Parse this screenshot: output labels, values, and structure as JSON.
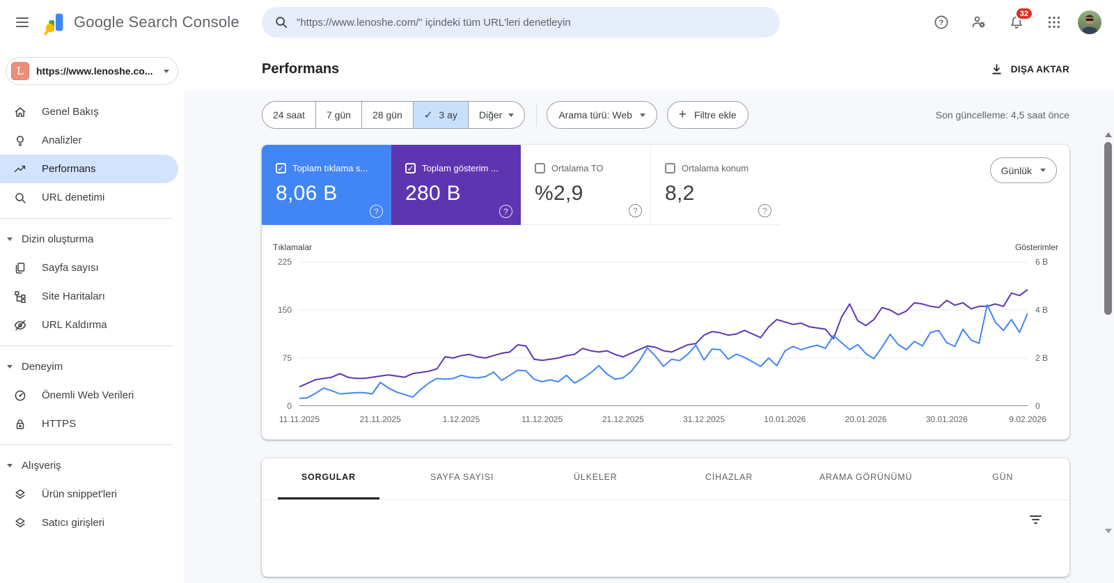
{
  "header": {
    "app_title": "Google Search Console",
    "search_placeholder": "\"https://www.lenoshe.com/\" içindeki tüm URL'leri denetleyin",
    "notification_count": "32"
  },
  "sidebar": {
    "property_badge": "L",
    "property_label": "https://www.lenoshe.co...",
    "nav": [
      {
        "type": "item",
        "icon": "home-icon",
        "label": "Genel Bakış"
      },
      {
        "type": "item",
        "icon": "lightbulb-icon",
        "label": "Analizler"
      },
      {
        "type": "item",
        "icon": "trending-up-icon",
        "label": "Performans",
        "selected": true
      },
      {
        "type": "item",
        "icon": "search-icon",
        "label": "URL denetimi"
      },
      {
        "type": "divider"
      },
      {
        "type": "section",
        "label": "Dizin oluşturma"
      },
      {
        "type": "item",
        "icon": "pages-icon",
        "label": "Sayfa sayısı"
      },
      {
        "type": "item",
        "icon": "sitemap-icon",
        "label": "Site Haritaları"
      },
      {
        "type": "item",
        "icon": "eye-off-icon",
        "label": "URL Kaldırma"
      },
      {
        "type": "divider"
      },
      {
        "type": "section",
        "label": "Deneyim"
      },
      {
        "type": "item",
        "icon": "speedometer-icon",
        "label": "Önemli Web Verileri"
      },
      {
        "type": "item",
        "icon": "lock-icon",
        "label": "HTTPS"
      },
      {
        "type": "divider"
      },
      {
        "type": "section",
        "label": "Alışveriş"
      },
      {
        "type": "item",
        "icon": "layers-icon",
        "label": "Ürün snippet'leri"
      },
      {
        "type": "item",
        "icon": "layers-icon",
        "label": "Satıcı girişleri"
      }
    ]
  },
  "page": {
    "title": "Performans",
    "export_label": "DIŞA AKTAR",
    "last_update": "Son güncelleme: 4,5 saat önce",
    "range_24h": "24 saat",
    "range_7d": "7 gün",
    "range_28d": "28 gün",
    "range_3m": "3 ay",
    "range_more": "Diğer",
    "search_type": "Arama türü: Web",
    "add_filter": "Filtre ekle",
    "granularity": "Günlük"
  },
  "metrics": [
    {
      "label": "Toplam tıklama s...",
      "value": "8,06 B",
      "checked": true,
      "color": "#4285f4"
    },
    {
      "label": "Toplam gösterim ...",
      "value": "280 B",
      "checked": true,
      "color": "#5e35b1"
    },
    {
      "label": "Ortalama TO",
      "value": "%2,9",
      "checked": false
    },
    {
      "label": "Ortalama konum",
      "value": "8,2",
      "checked": false
    }
  ],
  "tabs": [
    "SORGULAR",
    "SAYFA SAYISI",
    "ÜLKELER",
    "CİHAZLAR",
    "ARAMA GÖRÜNÜMÜ",
    "GÜN"
  ],
  "chart_data": {
    "type": "line",
    "title": "Performans: tıklamalar ve gösterimler (3 ay, günlük)",
    "legend_position": "none",
    "grid": true,
    "x_start": "11.11.2025",
    "x_end": "9.02.2026",
    "x_ticks": [
      "11.11.2025",
      "21.11.2025",
      "1.12.2025",
      "11.12.2025",
      "21.12.2025",
      "31.12.2025",
      "10.01.2026",
      "20.01.2026",
      "30.01.2026",
      "9.02.2026"
    ],
    "left_axis": {
      "label": "Tıklamalar",
      "ticks": [
        "225",
        "150",
        "75",
        "0"
      ],
      "min": 0,
      "max": 225
    },
    "right_axis": {
      "label": "Gösterimler",
      "ticks": [
        "6 B",
        "4 B",
        "2 B",
        "0"
      ],
      "min": 0,
      "max": 6000
    },
    "series": [
      {
        "name": "Gösterimler",
        "axis": "right",
        "color": "#5e35b1",
        "values": [
          800,
          950,
          1100,
          1150,
          1200,
          1350,
          1200,
          1150,
          1150,
          1200,
          1250,
          1300,
          1250,
          1200,
          1350,
          1400,
          1450,
          1550,
          2050,
          2000,
          2100,
          2150,
          2050,
          2000,
          2100,
          2200,
          2250,
          2550,
          2500,
          1950,
          1900,
          1950,
          2000,
          2100,
          2150,
          2400,
          2300,
          2250,
          2300,
          2150,
          2050,
          2200,
          2350,
          2500,
          2450,
          2300,
          2250,
          2400,
          2550,
          2600,
          2950,
          3100,
          3050,
          2950,
          3000,
          3150,
          3000,
          2850,
          3300,
          3600,
          3500,
          3400,
          3450,
          3300,
          3250,
          3200,
          2800,
          3700,
          4250,
          3550,
          3350,
          3600,
          4100,
          4000,
          3800,
          3950,
          4300,
          4250,
          4150,
          4100,
          4400,
          4200,
          4300,
          4050,
          4150,
          4150,
          4250,
          4150,
          4700,
          4600,
          4850
        ]
      },
      {
        "name": "Tıklamalar",
        "axis": "left",
        "color": "#4285f4",
        "values": [
          12,
          13,
          20,
          28,
          24,
          19,
          20,
          21,
          21,
          19,
          37,
          28,
          22,
          18,
          14,
          26,
          36,
          43,
          42,
          43,
          48,
          45,
          44,
          46,
          53,
          40,
          48,
          56,
          55,
          42,
          38,
          41,
          38,
          48,
          36,
          43,
          52,
          63,
          50,
          42,
          44,
          54,
          70,
          91,
          78,
          62,
          73,
          71,
          81,
          95,
          72,
          89,
          88,
          73,
          81,
          76,
          69,
          62,
          75,
          63,
          86,
          93,
          88,
          92,
          95,
          90,
          110,
          99,
          88,
          96,
          82,
          74,
          92,
          112,
          96,
          88,
          101,
          94,
          115,
          118,
          99,
          93,
          120,
          103,
          98,
          158,
          131,
          118,
          135,
          115,
          145
        ]
      }
    ]
  }
}
